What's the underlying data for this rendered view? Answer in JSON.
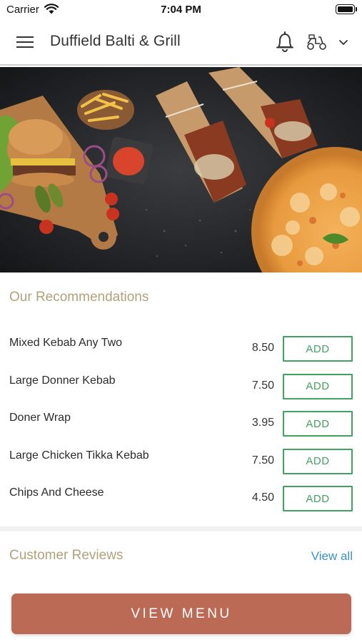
{
  "status_bar": {
    "carrier": "Carrier",
    "time": "7:04 PM"
  },
  "header": {
    "title": "Duffield Balti & Grill",
    "icons": [
      "hamburger-menu-icon",
      "bell-icon",
      "scooter-icon",
      "chevron-down-icon"
    ]
  },
  "hero": {
    "description_icon": "food-photo-banner"
  },
  "recommendations": {
    "title": "Our Recommendations",
    "items": [
      {
        "name": "Mixed Kebab Any Two",
        "price": "8.50",
        "button": "ADD"
      },
      {
        "name": "Large Donner Kebab",
        "price": "7.50",
        "button": "ADD"
      },
      {
        "name": "Doner Wrap",
        "price": "3.95",
        "button": "ADD"
      },
      {
        "name": "Large Chicken Tikka Kebab",
        "price": "7.50",
        "button": "ADD"
      },
      {
        "name": "Chips And Cheese",
        "price": "4.50",
        "button": "ADD"
      }
    ]
  },
  "reviews": {
    "title": "Customer Reviews",
    "view_all": "View all"
  },
  "footer": {
    "view_menu": "VIEW MENU"
  },
  "colors": {
    "section_title": "#b0a27b",
    "add_button": "#42a162",
    "link": "#3a91c4",
    "cta": "#bb6a55"
  }
}
